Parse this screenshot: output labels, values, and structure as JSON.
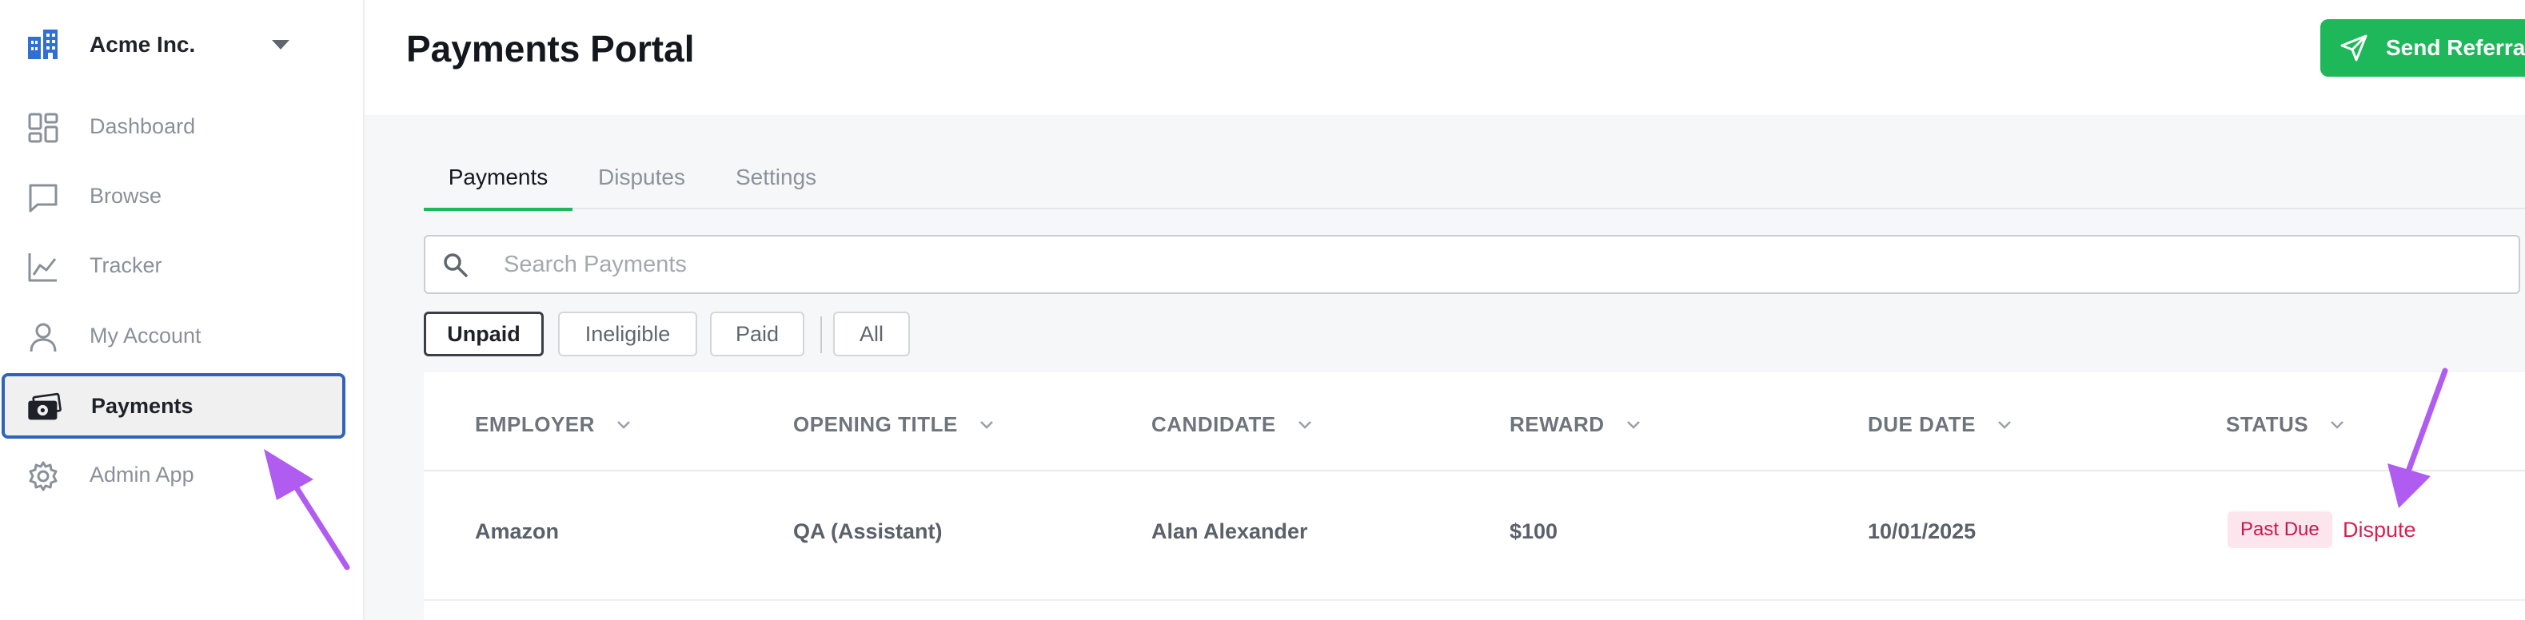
{
  "org": {
    "name": "Acme Inc."
  },
  "sidebar": {
    "items": [
      {
        "label": "Dashboard",
        "icon": "dashboard-icon"
      },
      {
        "label": "Browse",
        "icon": "chat-bubble-icon"
      },
      {
        "label": "Tracker",
        "icon": "line-chart-icon"
      },
      {
        "label": "My Account",
        "icon": "person-icon"
      },
      {
        "label": "Payments",
        "icon": "money-icon",
        "active": true
      },
      {
        "label": "Admin App",
        "icon": "gear-icon"
      }
    ]
  },
  "header": {
    "title": "Payments Portal",
    "referral_label": "Send Referral",
    "referral_color": "#1eb75a"
  },
  "tabs": [
    {
      "label": "Payments",
      "active": true
    },
    {
      "label": "Disputes"
    },
    {
      "label": "Settings"
    }
  ],
  "search": {
    "placeholder": "Search Payments",
    "value": ""
  },
  "filters": [
    {
      "label": "Unpaid",
      "active": true
    },
    {
      "label": "Ineligible"
    },
    {
      "label": "Paid"
    },
    {
      "label": "All"
    }
  ],
  "table": {
    "columns": [
      "EMPLOYER",
      "OPENING TITLE",
      "CANDIDATE",
      "REWARD",
      "DUE DATE",
      "STATUS"
    ],
    "rows": [
      {
        "employer": "Amazon",
        "opening_title": "QA (Assistant)",
        "candidate": "Alan Alexander",
        "reward": "$100",
        "due_date": "10/01/2025",
        "status": "Past Due",
        "action": "Dispute"
      }
    ]
  },
  "colors": {
    "accent": "#1eb75a",
    "active_outline": "#2f65b8",
    "status_past_due": "#c8174a",
    "annotation_arrow": "#b05cf0"
  }
}
